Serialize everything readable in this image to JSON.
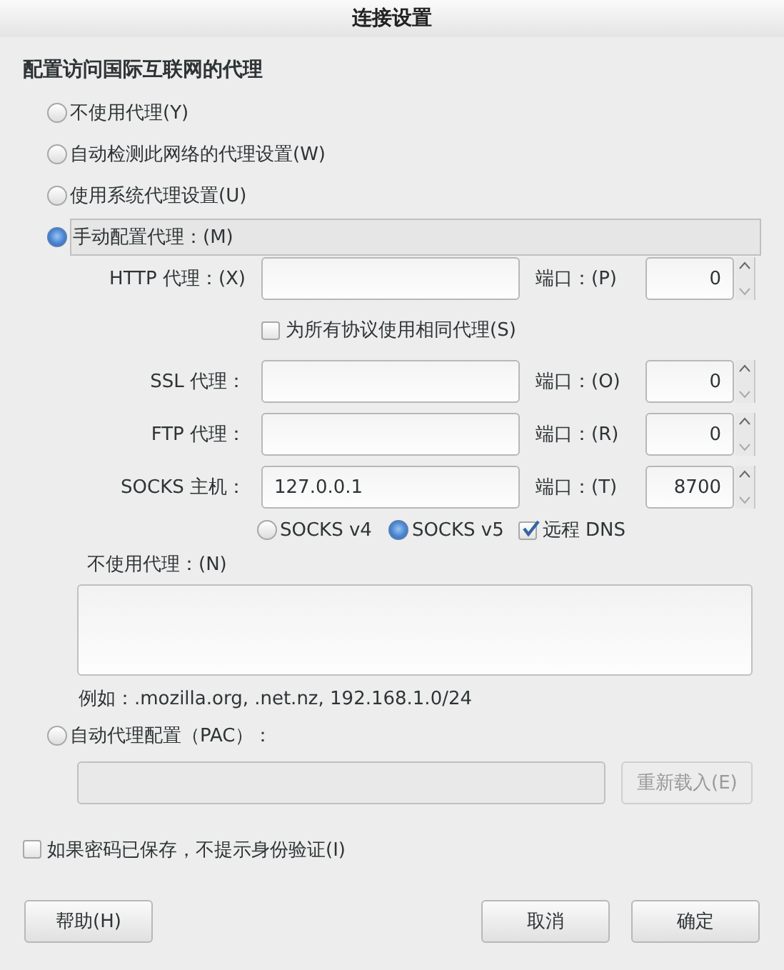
{
  "window": {
    "title": "连接设置"
  },
  "section_title": "配置访问国际互联网的代理",
  "proxy_modes": [
    {
      "label": "不使用代理(Y)",
      "selected": false
    },
    {
      "label": "自动检测此网络的代理设置(W)",
      "selected": false
    },
    {
      "label": "使用系统代理设置(U)",
      "selected": false
    },
    {
      "label": "手动配置代理：(M)",
      "selected": true
    },
    {
      "label": "自动代理配置（PAC）：",
      "selected": false
    }
  ],
  "proxies": [
    {
      "label": "HTTP 代理：(X)",
      "port_label": "端口：(P)",
      "port": "0"
    },
    {
      "label": "SSL 代理：",
      "port_label": "端口：(O)",
      "port": "0"
    },
    {
      "label": "FTP 代理：",
      "port_label": "端口：(R)",
      "port": "0"
    },
    {
      "label": "SOCKS 主机：",
      "value": "127.0.0.1",
      "port_label": "端口：(T)",
      "port": "8700"
    }
  ],
  "same_proxy": {
    "label": "为所有协议使用相同代理(S)",
    "checked": false
  },
  "socks_versions": [
    {
      "label": "SOCKS v4",
      "selected": false
    },
    {
      "label": "SOCKS v5",
      "selected": true
    }
  ],
  "remote_dns": {
    "label": "远程 DNS",
    "checked": true
  },
  "no_proxy": {
    "label": "不使用代理：(N)",
    "example": "例如：.mozilla.org, .net.nz, 192.168.1.0/24"
  },
  "pac": {
    "disabled": true,
    "reload_button": "重新载入(E)"
  },
  "auto_login": {
    "label": "如果密码已保存，不提示身份验证(I)",
    "checked": false
  },
  "buttons": [
    {
      "label": "帮助(H)"
    },
    {
      "label": "取消"
    },
    {
      "label": "确定"
    }
  ]
}
